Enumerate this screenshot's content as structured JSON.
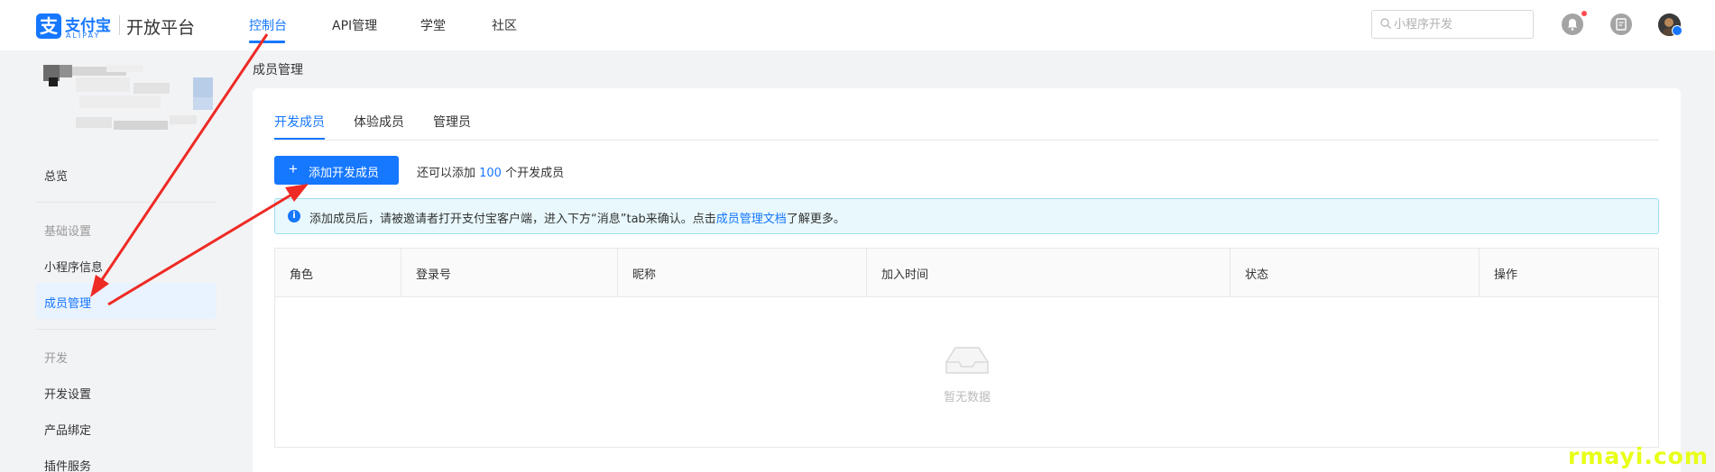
{
  "header": {
    "logo_char": "支",
    "logo_name": "支付宝",
    "logo_en": "ALIPAY",
    "platform": "开放平台",
    "nav": [
      "控制台",
      "API管理",
      "学堂",
      "社区"
    ],
    "search_placeholder": "小程序开发"
  },
  "sidebar": {
    "overview": "总览",
    "group_basic": "基础设置",
    "app_info": "小程序信息",
    "member_mgmt": "成员管理",
    "group_dev": "开发",
    "dev_settings": "开发设置",
    "product_binding": "产品绑定",
    "plugin_service": "插件服务"
  },
  "main": {
    "page_title": "成员管理",
    "tabs": [
      "开发成员",
      "体验成员",
      "管理员"
    ],
    "add_button": "添加开发成员",
    "quota_prefix": "还可以添加 ",
    "quota_num": "100",
    "quota_suffix": " 个开发成员",
    "alert_text": "添加成员后，请被邀请者打开支付宝客户端，进入下方“消息”tab来确认。点击",
    "alert_link": "成员管理文档",
    "alert_suffix": "了解更多。",
    "columns": [
      "角色",
      "登录号",
      "昵称",
      "加入时间",
      "状态",
      "操作"
    ],
    "empty_text": "暂无数据"
  },
  "watermark": "rmayi.com",
  "colors": {
    "primary": "#1677ff",
    "arrow": "#ee2a24",
    "alert_bg": "#e8f8fd"
  }
}
